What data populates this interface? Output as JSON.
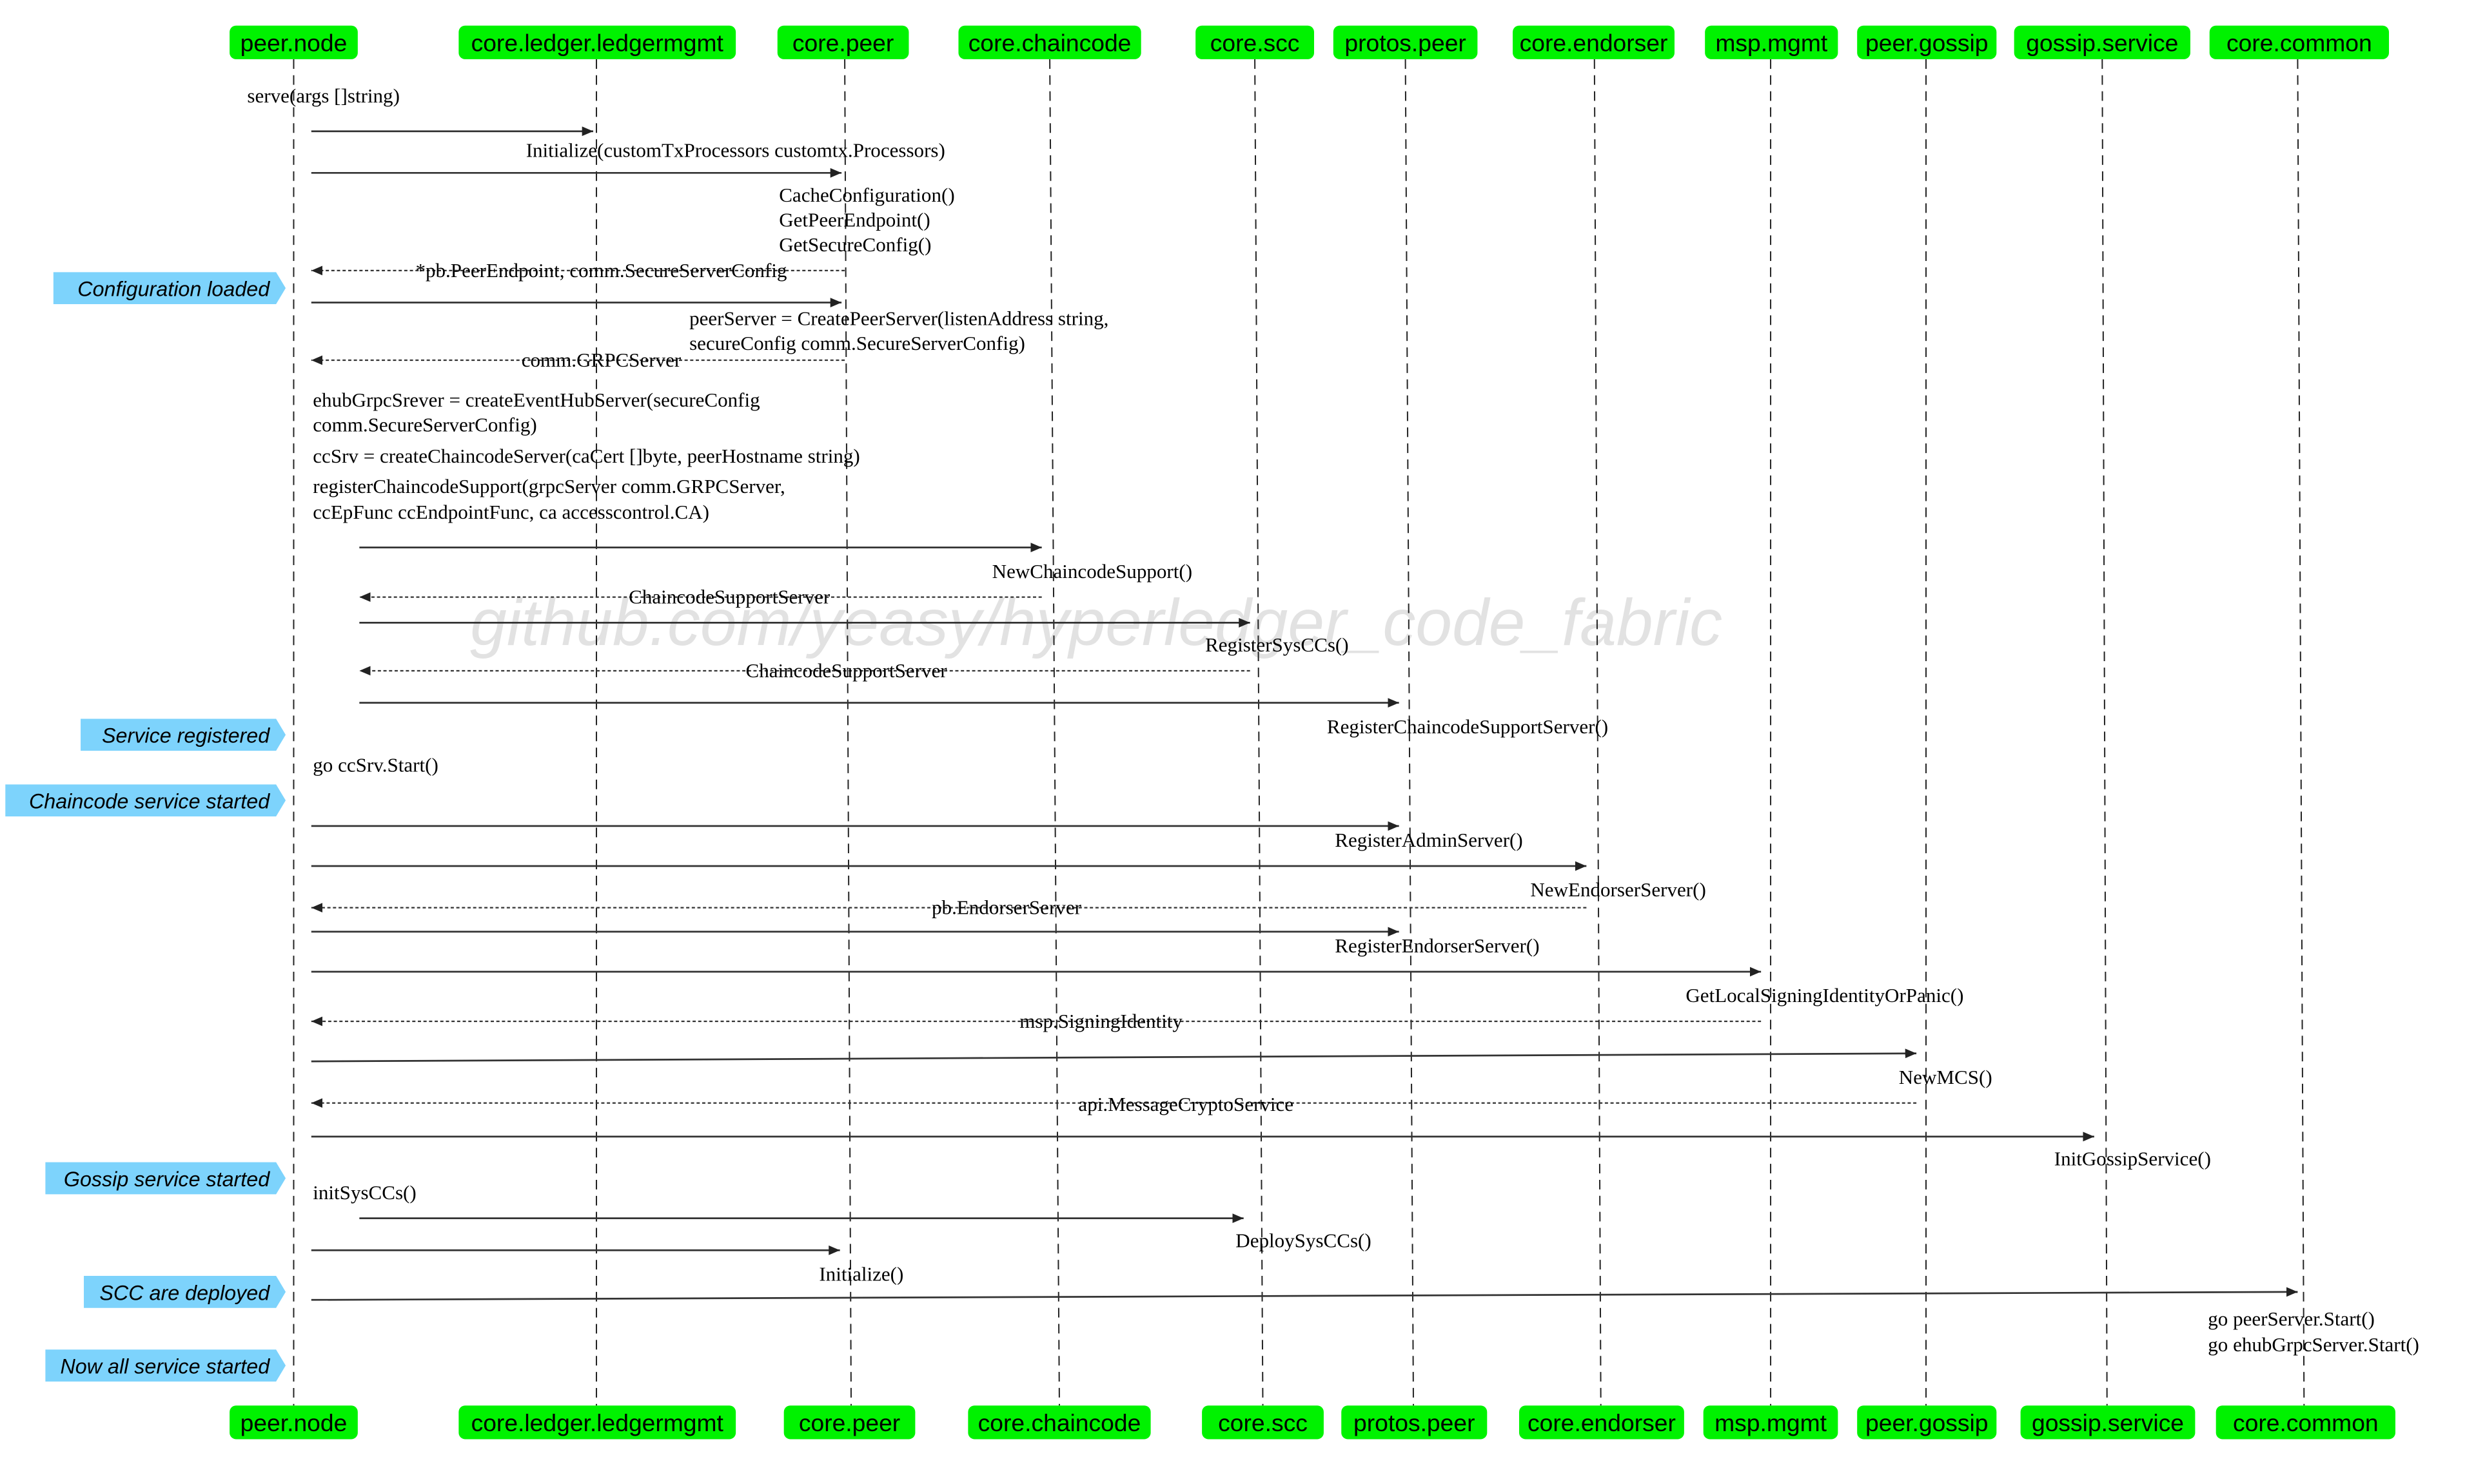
{
  "participants": [
    "peer.node",
    "core.ledger.ledgermgmt",
    "core.peer",
    "core.chaincode",
    "core.scc",
    "protos.peer",
    "core.endorser",
    "msp.mgmt",
    "peer.gossip",
    "gossip.service",
    "core.common"
  ],
  "watermark": "github.com/yeasy/hyperledger_code_fabric",
  "self_texts": [
    [
      "serve(args []string)"
    ],
    [
      "ehubGrpcSrever = createEventHubServer(secureConfig",
      "comm.SecureServerConfig)"
    ],
    [
      "ccSrv = createChaincodeServer(caCert []byte, peerHostname string)"
    ],
    [
      "registerChaincodeSupport(grpcServer comm.GRPCServer,",
      "ccEpFunc ccEndpointFunc, ca accesscontrol.CA)"
    ],
    [
      "go ccSrv.Start()"
    ],
    [
      "initSysCCs()"
    ]
  ],
  "messages": [
    {
      "from": "peer.node",
      "to": "core.ledger.ledgermgmt",
      "kind": "call",
      "label": [
        "Initialize(customTxProcessors customtx.Processors)"
      ]
    },
    {
      "from": "peer.node",
      "to": "core.peer",
      "kind": "call",
      "label": [
        "CacheConfiguration()",
        "GetPeerEndpoint()",
        "GetSecureConfig()"
      ]
    },
    {
      "from": "core.peer",
      "to": "peer.node",
      "kind": "return",
      "label": [
        "*pb.PeerEndpoint, comm.SecureServerConfig"
      ]
    },
    {
      "from": "peer.node",
      "to": "core.peer",
      "kind": "call",
      "label": [
        "peerServer = CreatePeerServer(listenAddress string,",
        "secureConfig comm.SecureServerConfig)"
      ]
    },
    {
      "from": "core.peer",
      "to": "peer.node",
      "kind": "return",
      "label": [
        "comm.GRPCServer"
      ]
    },
    {
      "from": "peer.node",
      "to": "core.chaincode",
      "kind": "call",
      "label": [
        "NewChaincodeSupport()"
      ]
    },
    {
      "from": "core.chaincode",
      "to": "peer.node",
      "kind": "return",
      "label": [
        "ChaincodeSupportServer"
      ]
    },
    {
      "from": "peer.node",
      "to": "core.scc",
      "kind": "call",
      "label": [
        "RegisterSysCCs()"
      ]
    },
    {
      "from": "core.scc",
      "to": "peer.node",
      "kind": "return",
      "label": [
        "ChaincodeSupportServer"
      ]
    },
    {
      "from": "peer.node",
      "to": "protos.peer",
      "kind": "call",
      "label": [
        "RegisterChaincodeSupportServer()"
      ]
    },
    {
      "from": "peer.node",
      "to": "protos.peer",
      "kind": "call",
      "label": [
        "RegisterAdminServer()"
      ]
    },
    {
      "from": "peer.node",
      "to": "core.endorser",
      "kind": "call",
      "label": [
        "NewEndorserServer()"
      ]
    },
    {
      "from": "core.endorser",
      "to": "peer.node",
      "kind": "return",
      "label": [
        "pb.EndorserServer"
      ]
    },
    {
      "from": "peer.node",
      "to": "protos.peer",
      "kind": "call",
      "label": [
        "RegisterEndorserServer()"
      ]
    },
    {
      "from": "peer.node",
      "to": "msp.mgmt",
      "kind": "call",
      "label": [
        "GetLocalSigningIdentityOrPanic()"
      ]
    },
    {
      "from": "msp.mgmt",
      "to": "peer.node",
      "kind": "return",
      "label": [
        "msp.SigningIdentity"
      ]
    },
    {
      "from": "peer.node",
      "to": "peer.gossip",
      "kind": "call",
      "label": [
        "NewMCS()"
      ]
    },
    {
      "from": "peer.gossip",
      "to": "peer.node",
      "kind": "return",
      "label": [
        "api.MessageCryptoService"
      ]
    },
    {
      "from": "peer.node",
      "to": "gossip.service",
      "kind": "call",
      "label": [
        "InitGossipService()"
      ]
    },
    {
      "from": "peer.node",
      "to": "core.scc",
      "kind": "call",
      "label": [
        "DeploySysCCs()"
      ]
    },
    {
      "from": "peer.node",
      "to": "core.peer",
      "kind": "call",
      "label": [
        "Initialize()"
      ]
    },
    {
      "from": "peer.node",
      "to": "core.common",
      "kind": "call",
      "label": [
        "go peerServer.Start()",
        "go ehubGrpcServer.Start()"
      ]
    }
  ],
  "notes": [
    "Configuration loaded",
    "Service registered",
    "Chaincode service started",
    "Gossip service started",
    "SCC are deployed",
    "Now all service started"
  ],
  "colors": {
    "participant_box": "#00f200",
    "note": "#7dd3fc",
    "watermark": "#e2e2e2"
  }
}
